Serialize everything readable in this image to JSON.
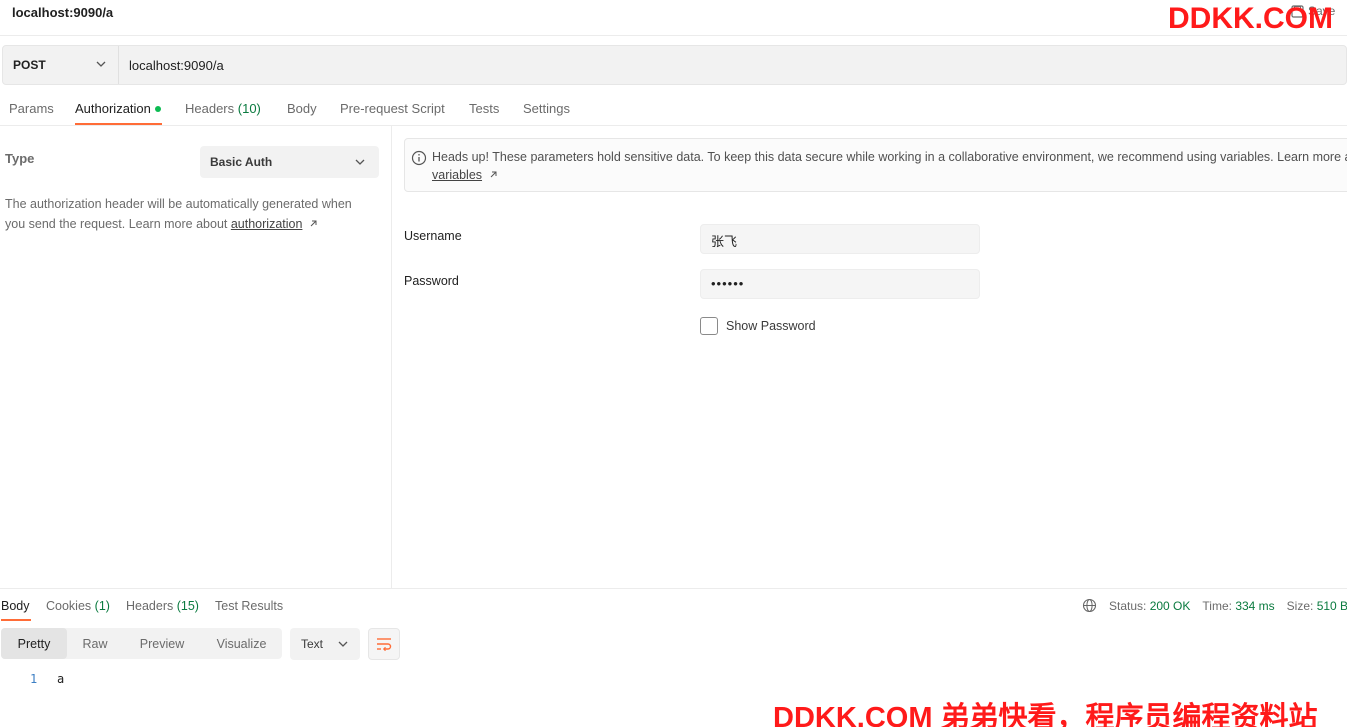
{
  "window": {
    "title": "localhost:9090/a",
    "save_label": "Save"
  },
  "watermark": {
    "top": "DDKK.COM",
    "bottom": "DDKK.COM 弟弟快看，程序员编程资料站"
  },
  "request": {
    "method": "POST",
    "url": "localhost:9090/a"
  },
  "request_tabs": [
    {
      "label": "Params",
      "count": ""
    },
    {
      "label": "Authorization",
      "count": ""
    },
    {
      "label": "Headers",
      "count": "(10)"
    },
    {
      "label": "Body",
      "count": ""
    },
    {
      "label": "Pre-request Script",
      "count": ""
    },
    {
      "label": "Tests",
      "count": ""
    },
    {
      "label": "Settings",
      "count": ""
    }
  ],
  "auth": {
    "type_label": "Type",
    "type_value": "Basic Auth",
    "description": "The authorization header will be automatically generated when you send the request. Learn more about ",
    "description_link": "authorization",
    "notice_text": "Heads up! These parameters hold sensitive data. To keep this data secure while working in a collaborative environment, we recommend using variables. Learn more about",
    "notice_link": "variables",
    "username_label": "Username",
    "username_value": "张飞",
    "password_label": "Password",
    "password_value": "••••••",
    "show_password_label": "Show Password"
  },
  "response_tabs": [
    {
      "label": "Body",
      "count": ""
    },
    {
      "label": "Cookies",
      "count": "(1)"
    },
    {
      "label": "Headers",
      "count": "(15)"
    },
    {
      "label": "Test Results",
      "count": ""
    }
  ],
  "status": {
    "status_label": "Status:",
    "status_value": "200 OK",
    "time_label": "Time:",
    "time_value": "334 ms",
    "size_label": "Size:",
    "size_value": "510 B"
  },
  "view_tabs": [
    "Pretty",
    "Raw",
    "Preview",
    "Visualize"
  ],
  "format": "Text",
  "code_lines": [
    {
      "num": "1",
      "text": "a"
    }
  ],
  "colors": {
    "accent": "#ff6c37",
    "success": "#0a7a3f",
    "watermark": "#ff1a1a"
  }
}
